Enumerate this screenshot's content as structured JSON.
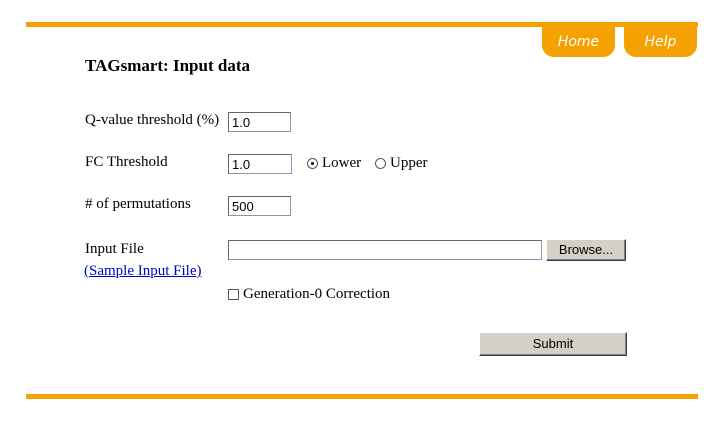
{
  "nav": {
    "home": "Home",
    "help": "Help"
  },
  "page": {
    "title": "TAGsmart: Input data"
  },
  "form": {
    "qvalue": {
      "label": "Q-value threshold (%)",
      "value": "1.0"
    },
    "fc": {
      "label": "FC Threshold",
      "value": "1.0",
      "options": [
        "Lower",
        "Upper"
      ],
      "selected": "Lower"
    },
    "permutations": {
      "label": "# of permutations",
      "value": "500"
    },
    "input_file": {
      "label": "Input File",
      "value": "",
      "browse_label": "Browse...",
      "sample_link": "(Sample Input File)"
    },
    "generation_correction": {
      "label": "Generation-0 Correction",
      "checked": false
    },
    "submit_label": "Submit"
  },
  "colors": {
    "accent": "#f5a100",
    "link": "#0000cc"
  }
}
